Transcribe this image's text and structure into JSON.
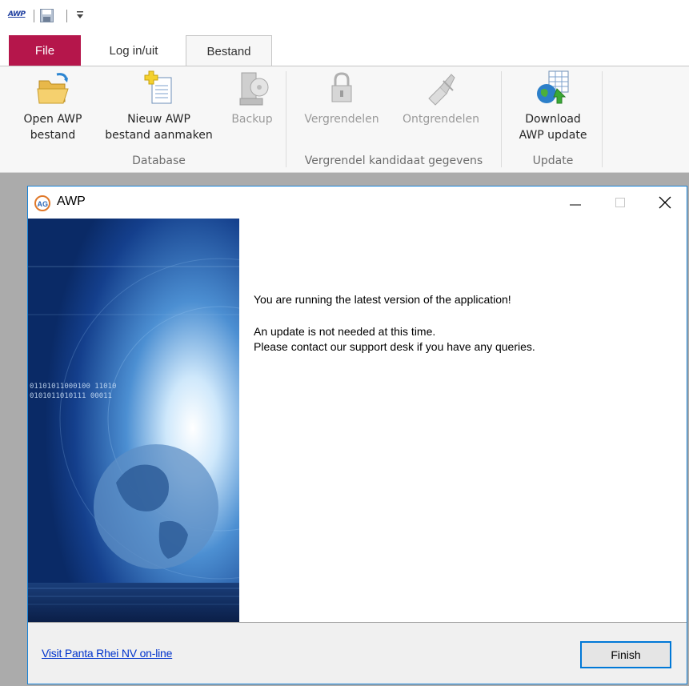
{
  "quick_access": {
    "logo_text": "AWP",
    "save_icon": "save-icon",
    "customize_icon": "customize-dropdown-icon"
  },
  "tabs": [
    {
      "label": "File"
    },
    {
      "label": "Log in/uit"
    },
    {
      "label": "Bestand"
    }
  ],
  "ribbon": {
    "groups": {
      "database": "Database",
      "vergrendel": "Vergrendel kandidaat gegevens",
      "update": "Update"
    },
    "buttons": {
      "open_line1": "Open AWP",
      "open_line2": "bestand",
      "nieuw_line1": "Nieuw AWP",
      "nieuw_line2": "bestand aanmaken",
      "backup": "Backup",
      "vergrendelen": "Vergrendelen",
      "ontgrendelen": "Ontgrendelen",
      "download_line1": "Download",
      "download_line2": "AWP update"
    }
  },
  "dialog": {
    "title": "AWP",
    "message_main": "You are running the latest version of the application!",
    "message_line2": "An update is not needed at this time.",
    "message_line3": "Please contact our support desk if you have any queries.",
    "link": "Visit Panta Rhei NV on-line",
    "finish_label": "Finish",
    "side_binary_1": "01101011000100 11010",
    "side_binary_2": "0101011010111 00011"
  },
  "colors": {
    "file_tab": "#b5164b",
    "accent": "#0078d7",
    "link": "#0033cc"
  }
}
